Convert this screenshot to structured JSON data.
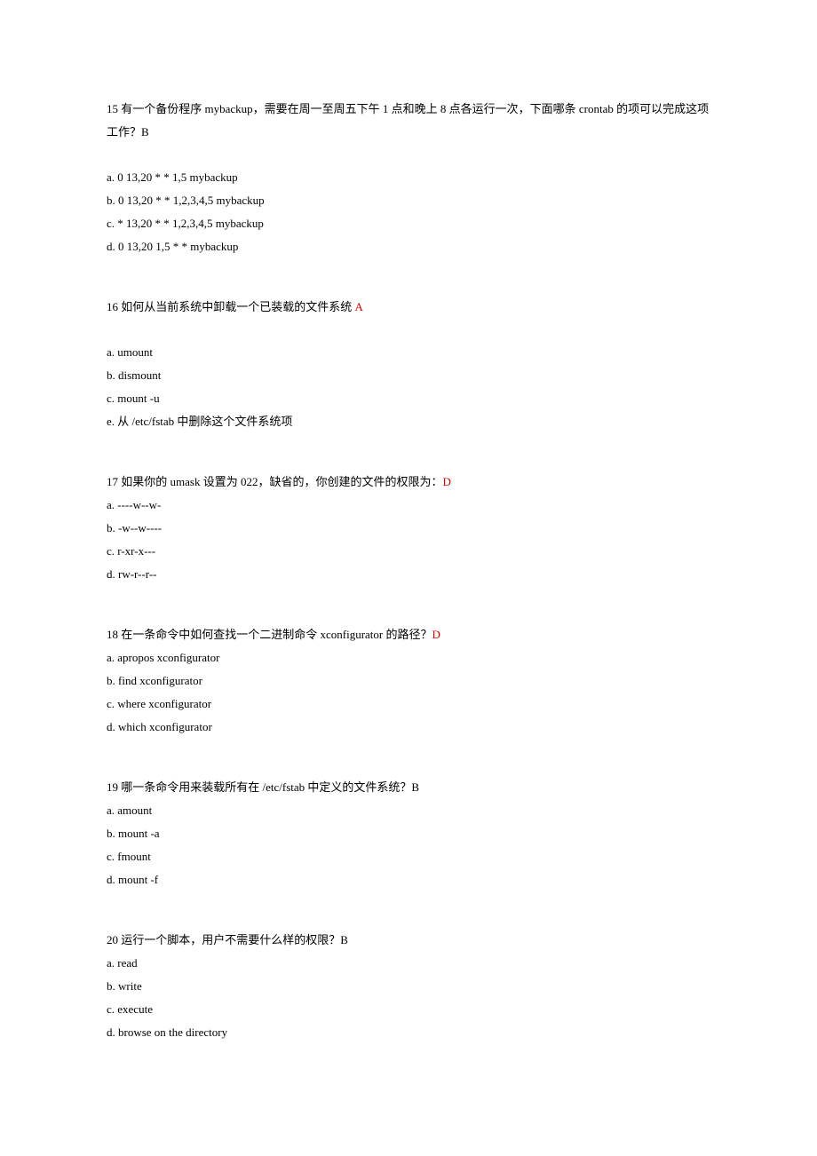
{
  "questions": [
    {
      "number": "15",
      "text": " 有一个备份程序 mybackup，需要在周一至周五下午 1 点和晚上 8 点各运行一次，下面哪条 crontab 的项可以完成这项工作？B",
      "answer_highlight": "",
      "options": [
        "a.  0  13,20  *  *  1,5  mybackup",
        "b.  0  13,20  *  *  1,2,3,4,5  mybackup",
        "c.  *  13,20  *  *  1,2,3,4,5  mybackup",
        "d.  0  13,20  1,5  *  *   mybackup"
      ],
      "spacer_before_options": true
    },
    {
      "number": "16",
      "text": " 如何从当前系统中卸载一个已装载的文件系统 ",
      "answer_highlight": "A",
      "options": [
        "a.  umount",
        "b.  dismount",
        "c.  mount  -u",
        "e.  从  /etc/fstab  中删除这个文件系统项"
      ],
      "spacer_before_options": true
    },
    {
      "number": "17",
      "text": " 如果你的 umask 设置为 022，缺省的，你创建的文件的权限为：",
      "answer_highlight": "D",
      "options": [
        "a.  ----w--w-",
        "b.  -w--w----",
        "c.  r-xr-x---",
        "d.  rw-r--r--"
      ],
      "spacer_before_options": false
    },
    {
      "number": "18",
      "text": " 在一条命令中如何查找一个二进制命令  xconfigurator  的路径？",
      "answer_highlight": "D",
      "options": [
        "a.  apropos  xconfigurator",
        "b.  find  xconfigurator",
        "c.  where  xconfigurator",
        "d.  which  xconfigurator"
      ],
      "spacer_before_options": false
    },
    {
      "number": "19",
      "text": " 哪一条命令用来装载所有在  /etc/fstab  中定义的文件系统？B",
      "answer_highlight": "",
      "options": [
        "a.  amount",
        "b.  mount  -a",
        "c.  fmount",
        "d.  mount  -f"
      ],
      "spacer_before_options": false
    },
    {
      "number": "20",
      "text": " 运行一个脚本，用户不需要什么样的权限？B",
      "answer_highlight": "",
      "options": [
        "a.  read",
        "b.   write",
        "c.  execute",
        "d.  browse  on  the  directory"
      ],
      "spacer_before_options": false
    }
  ]
}
